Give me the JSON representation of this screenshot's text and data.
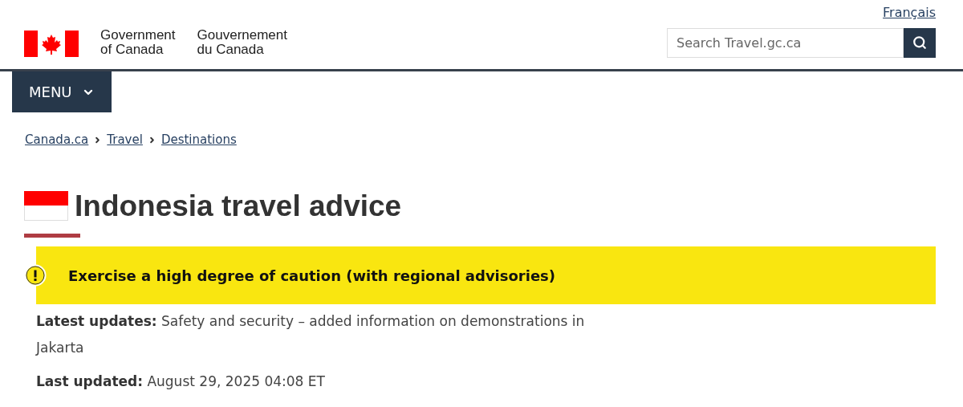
{
  "language_link": "Français",
  "signature": {
    "english": [
      "Government",
      "of Canada"
    ],
    "french": [
      "Gouvernement",
      "du Canada"
    ]
  },
  "search": {
    "placeholder": "Search Travel.gc.ca"
  },
  "menu": {
    "label": "MENU",
    "expanded": false
  },
  "breadcrumbs": [
    "Canada.ca",
    "Travel",
    "Destinations"
  ],
  "title": "Indonesia travel advice",
  "advisory": {
    "color": "#f9e610",
    "text": "Exercise a high degree of caution (with regional advisories)"
  },
  "updates": [
    "**Latest updates:** Safety and security – added information on demonstrations in Jakarta",
    "**Last updated:** August 29, 2025 04:08 ET"
  ]
}
